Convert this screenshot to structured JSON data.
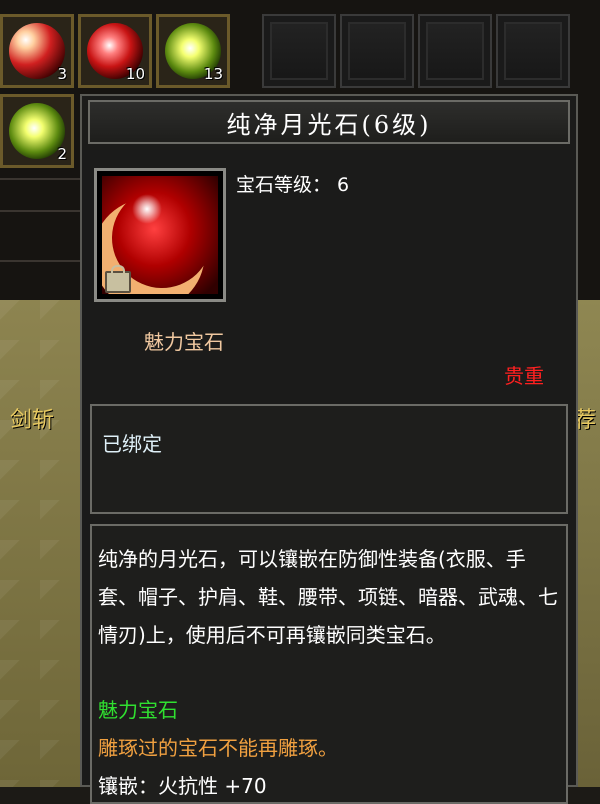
{
  "inventory": {
    "slots": [
      {
        "count": "3",
        "gem": "moonstone-red"
      },
      {
        "count": "10",
        "gem": "ruby-red"
      },
      {
        "count": "13",
        "gem": "topaz-yellow"
      },
      {
        "count": "2",
        "gem": "peridot-green"
      }
    ]
  },
  "background": {
    "left_label": "剑斩",
    "right_label": "荐"
  },
  "tooltip": {
    "title": "纯净月光石(6级)",
    "gem_level": "宝石等级：  6",
    "gem_type": "魅力宝石",
    "rarity": "贵重",
    "bind_status": "已绑定",
    "description": "纯净的月光石，可以镶嵌在防御性装备(衣服、手套、帽子、护肩、鞋、腰带、项链、暗器、武魂、七情刃)上，使用后不可再镶嵌同类宝石。",
    "category_line": "魅力宝石",
    "warning_line": "雕琢过的宝石不能再雕琢。",
    "inlay_line": "镶嵌：火抗性 +70"
  },
  "colors": {
    "title": "#ffffff",
    "gem_type": "#f0c8a0",
    "rarity": "#ff2020",
    "category": "#30e030",
    "warning": "#f0a040"
  },
  "icons": [
    "moonstone-gem-icon",
    "lock-icon"
  ]
}
